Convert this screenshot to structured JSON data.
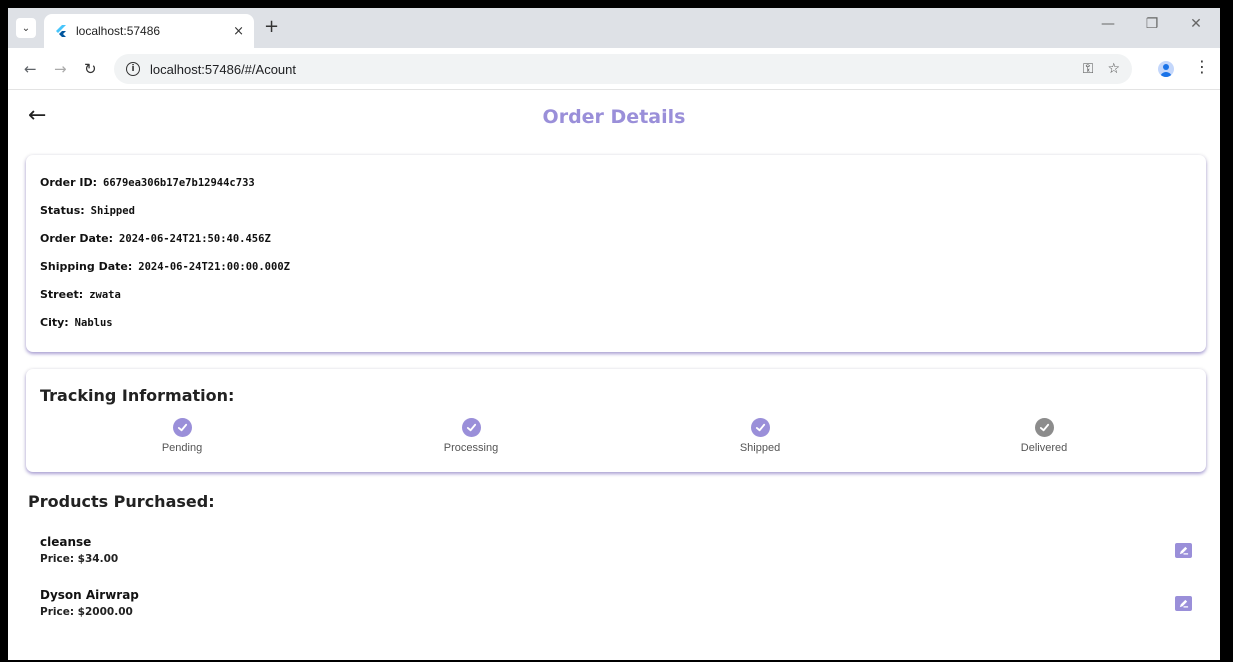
{
  "browser": {
    "tab_title": "localhost:57486",
    "url": "localhost:57486/#/Acount",
    "new_tab": "+",
    "tab_close": "×"
  },
  "app": {
    "title": "Order Details",
    "accent_color": "#9a8fd9"
  },
  "order": {
    "rows": [
      {
        "label": "Order ID:",
        "value": "6679ea306b17e7b12944c733"
      },
      {
        "label": "Status:",
        "value": "Shipped"
      },
      {
        "label": "Order Date:",
        "value": "2024-06-24T21:50:40.456Z"
      },
      {
        "label": "Shipping Date:",
        "value": "2024-06-24T21:00:00.000Z"
      },
      {
        "label": "Street:",
        "value": "zwata"
      },
      {
        "label": "City:",
        "value": "Nablus"
      }
    ]
  },
  "tracking": {
    "title": "Tracking Information:",
    "steps": [
      {
        "label": "Pending",
        "complete": true
      },
      {
        "label": "Processing",
        "complete": true
      },
      {
        "label": "Shipped",
        "complete": true
      },
      {
        "label": "Delivered",
        "complete": false
      }
    ],
    "complete_color": "#9a8fd9",
    "incomplete_color": "#8c8c8c"
  },
  "products": {
    "title": "Products Purchased:",
    "items": [
      {
        "name": "cleanse",
        "price": "Price: $34.00"
      },
      {
        "name": "Dyson Airwrap",
        "price": "Price: $2000.00"
      }
    ]
  }
}
